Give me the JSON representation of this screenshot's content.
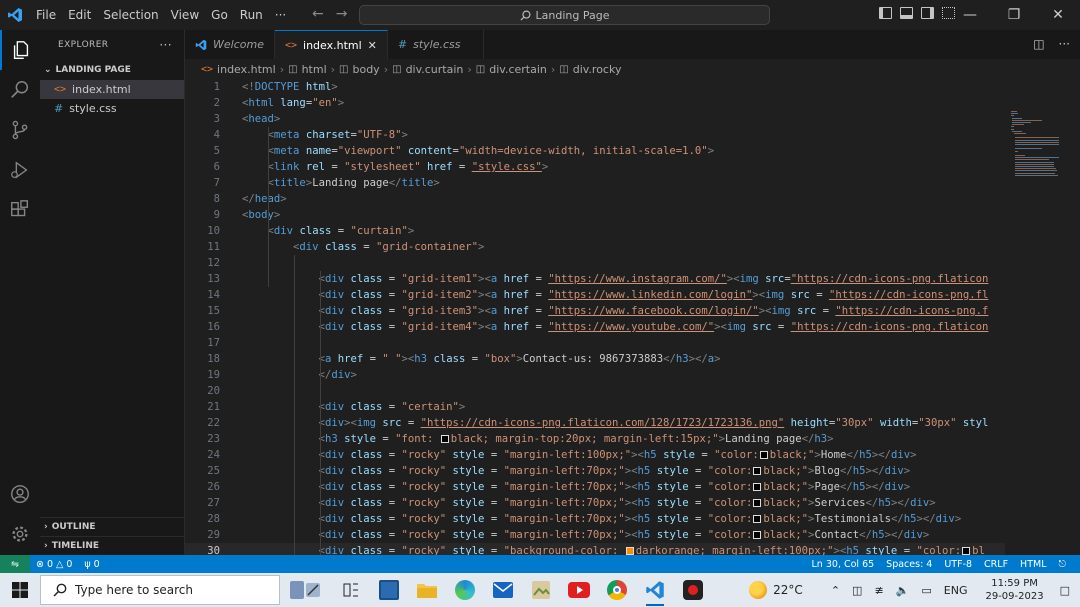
{
  "menu": [
    "File",
    "Edit",
    "Selection",
    "View",
    "Go",
    "Run",
    "···"
  ],
  "search": {
    "label": "Landing Page"
  },
  "sidebar": {
    "title": "EXPLORER",
    "more": "···",
    "section": "LANDING PAGE",
    "files": [
      {
        "name": "index.html",
        "icon": "<>",
        "icon_color": "#e37933",
        "selected": true
      },
      {
        "name": "style.css",
        "icon": "#",
        "icon_color": "#519aba",
        "selected": false
      }
    ],
    "outline": "OUTLINE",
    "timeline": "TIMELINE"
  },
  "tabs": [
    {
      "label": "Welcome",
      "icon": "vscode-icon",
      "active": false,
      "italic": true
    },
    {
      "label": "index.html",
      "icon": "<>",
      "active": true,
      "close": "✕"
    },
    {
      "label": "style.css",
      "icon": "#",
      "active": false,
      "italic": true
    }
  ],
  "breadcrumb": [
    "index.html",
    "html",
    "body",
    "div.curtain",
    "div.certain",
    "div.rocky"
  ],
  "code": {
    "current_line": 30,
    "lines": [
      {
        "n": "1",
        "t": "<!DOCTYPE html>"
      },
      {
        "n": "2",
        "t": "<html lang=\"en\">"
      },
      {
        "n": "3",
        "t": "<head>"
      },
      {
        "n": "4",
        "t": "    <meta charset=\"UTF-8\">"
      },
      {
        "n": "5",
        "t": "    <meta name=\"viewport\" content=\"width=device-width, initial-scale=1.0\">"
      },
      {
        "n": "6",
        "t": "    <link rel = \"stylesheet\" href = \"style.css\">"
      },
      {
        "n": "7",
        "t": "    <title>Landing page</title>"
      },
      {
        "n": "8",
        "t": "</head>"
      },
      {
        "n": "9",
        "t": "<body>"
      },
      {
        "n": "10",
        "t": "    <div class = \"curtain\">"
      },
      {
        "n": "11",
        "t": "        <div class = \"grid-container\">"
      },
      {
        "n": "12",
        "t": ""
      },
      {
        "n": "13",
        "t": "            <div class = \"grid-item1\"><a href = \"https://www.instagram.com/\"><img src=\"https://cdn-icons-png.flaticon"
      },
      {
        "n": "14",
        "t": "            <div class = \"grid-item2\"><a href = \"https://www.linkedin.com/login\"><img src = \"https://cdn-icons-png.fl"
      },
      {
        "n": "15",
        "t": "            <div class = \"grid-item3\"><a href = \"https://www.facebook.com/login/\"><img src = \"https://cdn-icons-png.f"
      },
      {
        "n": "16",
        "t": "            <div class = \"grid-item4\"><a href = \"https://www.youtube.com/\"><img src = \"https://cdn-icons-png.flaticon"
      },
      {
        "n": "17",
        "t": ""
      },
      {
        "n": "18",
        "t": "            <a href = \" \"><h3 class = \"box\">Contact-us: 9867373883</h3></a>"
      },
      {
        "n": "19",
        "t": "            </div>"
      },
      {
        "n": "20",
        "t": ""
      },
      {
        "n": "21",
        "t": "            <div class = \"certain\">"
      },
      {
        "n": "22",
        "t": "            <div><img src = \"https://cdn-icons-png.flaticon.com/128/1723/1723136.png\" height=\"30px\" width=\"30px\" styl"
      },
      {
        "n": "23",
        "t": "            <h3 style = \"font: □black; margin-top:20px; margin-left:15px;\">Landing page</h3>"
      },
      {
        "n": "24",
        "t": "            <div class = \"rocky\" style = \"margin-left:100px;\"><h5 style = \"color:□black;\">Home</h5></div>"
      },
      {
        "n": "25",
        "t": "            <div class = \"rocky\" style = \"margin-left:70px;\"><h5 style = \"color:□black;\">Blog</h5></div>"
      },
      {
        "n": "26",
        "t": "            <div class = \"rocky\" style = \"margin-left:70px;\"><h5 style = \"color:□black;\">Page</h5></div>"
      },
      {
        "n": "27",
        "t": "            <div class = \"rocky\" style = \"margin-left:70px;\"><h5 style = \"color:□black;\">Services</h5></div>"
      },
      {
        "n": "28",
        "t": "            <div class = \"rocky\" style = \"margin-left:70px;\"><h5 style = \"color:□black;\">Testimonials</h5></div>"
      },
      {
        "n": "29",
        "t": "            <div class = \"rocky\" style = \"margin-left:70px;\"><h5 style = \"color:□black;\">Contact</h5></div>"
      },
      {
        "n": "30",
        "t": "            <div class = \"rocky\" style = \"background-color: ■darkorange; margin-left:100px;\"><h5 style = \"color:□bl"
      }
    ]
  },
  "status": {
    "errors": "0",
    "warnings": "0",
    "ports": "0",
    "position": "Ln 30, Col 65",
    "spaces": "Spaces: 4",
    "encoding": "UTF-8",
    "eol": "CRLF",
    "language": "HTML"
  },
  "taskbar": {
    "search_placeholder": "Type here to search",
    "weather": "22°C",
    "language": "ENG",
    "time": "11:59 PM",
    "date": "29-09-2023"
  },
  "colors": {
    "accent": "#007acc",
    "tag": "#569cd6",
    "attr": "#9cdcfe",
    "string": "#ce9178",
    "punct": "#808080"
  }
}
